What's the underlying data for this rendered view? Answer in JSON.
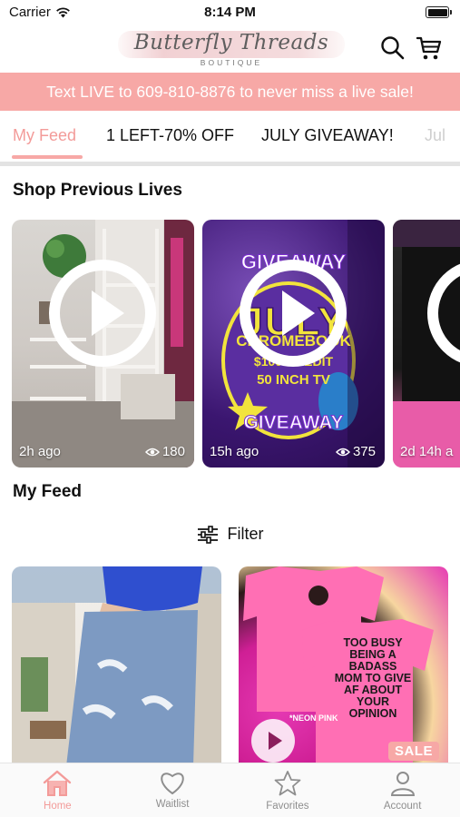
{
  "status_bar": {
    "carrier": "Carrier",
    "time": "8:14 PM"
  },
  "header": {
    "logo_text": "Butterfly Threads",
    "logo_subtext": "BOUTIQUE"
  },
  "banner": {
    "text": "Text LIVE to 609-810-8876 to never miss a live sale!"
  },
  "tabs": [
    {
      "label": "My Feed",
      "active": true
    },
    {
      "label": "1 LEFT-70% OFF"
    },
    {
      "label": "JULY GIVEAWAY!"
    },
    {
      "label": "Jul"
    }
  ],
  "previous_lives": {
    "title": "Shop Previous Lives",
    "cards": [
      {
        "time": "2h ago",
        "views": "180"
      },
      {
        "time": "15h ago",
        "views": "375"
      },
      {
        "time": "2d 14h a"
      }
    ],
    "giveaway_art": {
      "line1": "GIVEAWAY",
      "line2": "JULY",
      "line3": "CHROMEBOOK",
      "line4": "$100 CREDIT",
      "line5": "50 INCH TV",
      "line6": "GIVEAWAY"
    }
  },
  "feed": {
    "title": "My Feed",
    "filter_label": "Filter",
    "items": [
      {
        "badge": ""
      },
      {
        "badge": "SALE",
        "shirt_text": "TOO BUSY BEING A BADASS MOM TO GIVE AF ABOUT YOUR OPINION",
        "color_note": "*NEON PINK"
      }
    ]
  },
  "bottom_nav": [
    {
      "label": "Home",
      "icon": "home-icon",
      "active": true
    },
    {
      "label": "Waitlist",
      "icon": "heart-icon"
    },
    {
      "label": "Favorites",
      "icon": "star-icon"
    },
    {
      "label": "Account",
      "icon": "person-icon"
    }
  ],
  "colors": {
    "accent": "#f7a8a6",
    "accent_text": "#f39b99"
  }
}
